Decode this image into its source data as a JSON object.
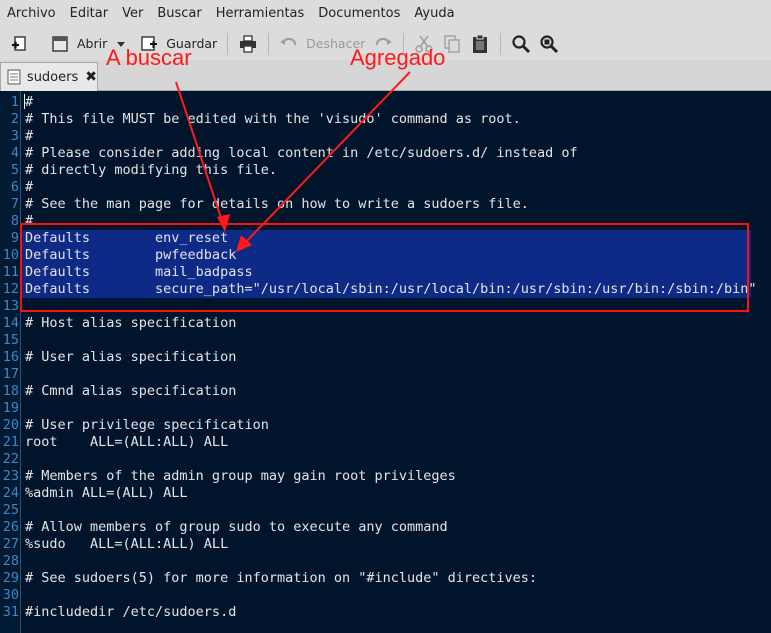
{
  "menubar": {
    "items": [
      "Archivo",
      "Editar",
      "Ver",
      "Buscar",
      "Herramientas",
      "Documentos",
      "Ayuda"
    ]
  },
  "toolbar": {
    "open_label": "Abrir",
    "save_label": "Guardar",
    "undo_label": "Deshacer"
  },
  "tab": {
    "name": "sudoers",
    "close": "✖"
  },
  "annotations": {
    "search": "A buscar",
    "added": "Agregado"
  },
  "colors": {
    "annotation": "#ff1a1a",
    "editor_bg": "#00152c",
    "selection_bg": "#0c2a86",
    "line_number": "#3f86c8"
  },
  "editor": {
    "lines": [
      {
        "n": "1",
        "text": "#"
      },
      {
        "n": "2",
        "text": "# This file MUST be edited with the 'visudo' command as root."
      },
      {
        "n": "3",
        "text": "#"
      },
      {
        "n": "4",
        "text": "# Please consider adding local content in /etc/sudoers.d/ instead of"
      },
      {
        "n": "5",
        "text": "# directly modifying this file."
      },
      {
        "n": "6",
        "text": "#"
      },
      {
        "n": "7",
        "text": "# See the man page for details on how to write a sudoers file."
      },
      {
        "n": "8",
        "text": "#"
      },
      {
        "n": "9",
        "text": "Defaults        env_reset"
      },
      {
        "n": "10",
        "text": "Defaults        pwfeedback"
      },
      {
        "n": "11",
        "text": "Defaults        mail_badpass"
      },
      {
        "n": "12",
        "text": "Defaults        secure_path=\"/usr/local/sbin:/usr/local/bin:/usr/sbin:/usr/bin:/sbin:/bin\""
      },
      {
        "n": "13",
        "text": ""
      },
      {
        "n": "14",
        "text": "# Host alias specification"
      },
      {
        "n": "15",
        "text": ""
      },
      {
        "n": "16",
        "text": "# User alias specification"
      },
      {
        "n": "17",
        "text": ""
      },
      {
        "n": "18",
        "text": "# Cmnd alias specification"
      },
      {
        "n": "19",
        "text": ""
      },
      {
        "n": "20",
        "text": "# User privilege specification"
      },
      {
        "n": "21",
        "text": "root    ALL=(ALL:ALL) ALL"
      },
      {
        "n": "22",
        "text": ""
      },
      {
        "n": "23",
        "text": "# Members of the admin group may gain root privileges"
      },
      {
        "n": "24",
        "text": "%admin ALL=(ALL) ALL"
      },
      {
        "n": "25",
        "text": ""
      },
      {
        "n": "26",
        "text": "# Allow members of group sudo to execute any command"
      },
      {
        "n": "27",
        "text": "%sudo   ALL=(ALL:ALL) ALL"
      },
      {
        "n": "28",
        "text": ""
      },
      {
        "n": "29",
        "text": "# See sudoers(5) for more information on \"#include\" directives:"
      },
      {
        "n": "30",
        "text": ""
      },
      {
        "n": "31",
        "text": "#includedir /etc/sudoers.d"
      }
    ]
  }
}
